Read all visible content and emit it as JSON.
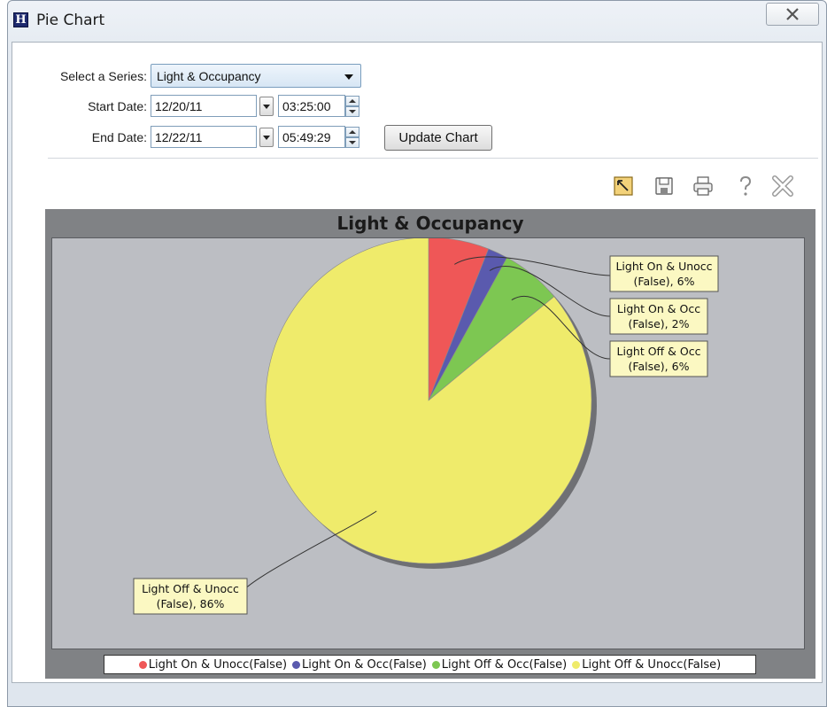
{
  "window": {
    "title": "Pie Chart",
    "app_icon": "H"
  },
  "form": {
    "series_label": "Select a Series:",
    "series_value": "Light & Occupancy",
    "start_label": "Start Date:",
    "start_date": "12/20/11",
    "start_time": "03:25:00",
    "end_label": "End Date:",
    "end_date": "12/22/11",
    "end_time": "05:49:29",
    "update_label": "Update Chart"
  },
  "toolbar": {
    "icons": [
      "zoom-icon",
      "save-icon",
      "print-icon",
      "help-icon",
      "close-chart-icon"
    ]
  },
  "colors": {
    "red": "#ef5757",
    "blue": "#5a5aae",
    "green": "#7dc752",
    "yellow": "#efeb6b",
    "plot_bg": "#bcbec3",
    "frame": "#808285"
  },
  "chart_data": {
    "type": "pie",
    "title": "Light & Occupancy",
    "categories": [
      "Light On & Unocc(False)",
      "Light On & Occ(False)",
      "Light Off & Occ(False)",
      "Light Off & Unocc(False)"
    ],
    "values": [
      6,
      2,
      6,
      86
    ],
    "labels": [
      [
        "Light On & Unocc",
        "(False), 6%"
      ],
      [
        "Light On & Occ",
        "(False), 2%"
      ],
      [
        "Light Off & Occ",
        "(False), 6%"
      ],
      [
        "Light Off & Unocc",
        "(False), 86%"
      ]
    ],
    "legend_position": "bottom"
  }
}
